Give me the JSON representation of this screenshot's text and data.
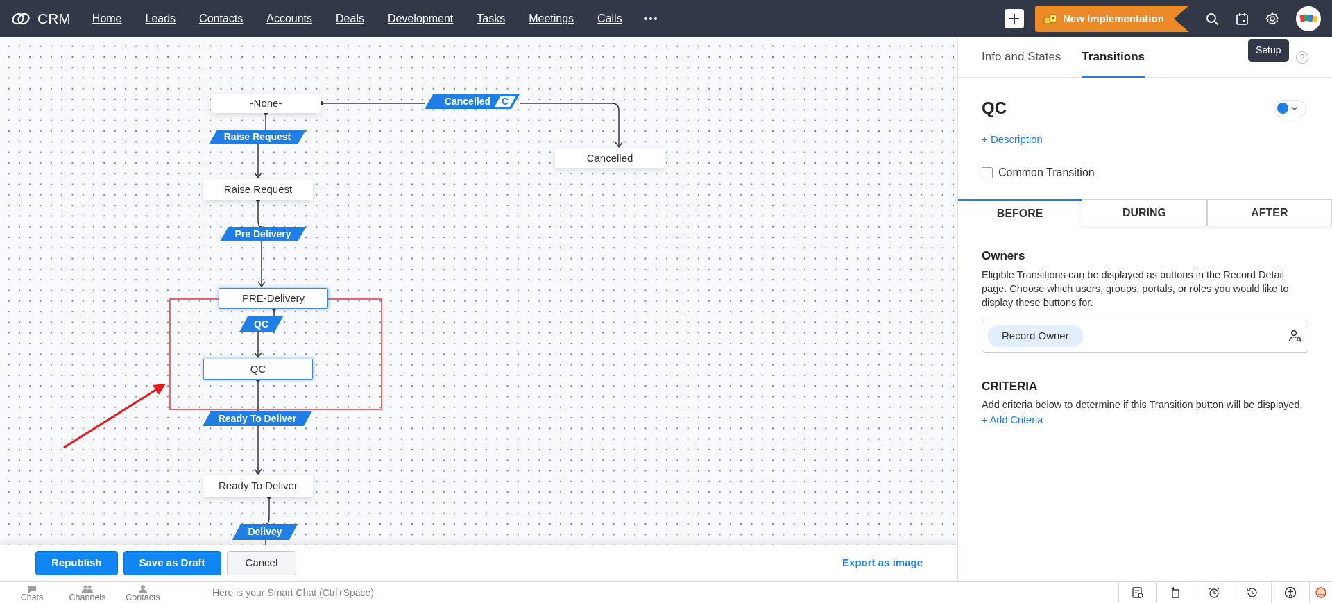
{
  "navbar": {
    "brand": "CRM",
    "items": [
      "Home",
      "Leads",
      "Contacts",
      "Accounts",
      "Deals",
      "Development",
      "Tasks",
      "Meetings",
      "Calls"
    ],
    "new_implementation": "New Implementation",
    "tooltip": "Setup"
  },
  "canvas": {
    "states": [
      {
        "label": "-None-",
        "selected": false
      },
      {
        "label": "Cancelled",
        "selected": false
      },
      {
        "label": "Raise Request",
        "selected": false
      },
      {
        "label": "PRE-Delivery",
        "selected": true
      },
      {
        "label": "QC",
        "selected": true
      },
      {
        "label": "Ready To Deliver",
        "selected": false
      }
    ],
    "transitions": [
      {
        "label": "Cancelled",
        "badge": "C"
      },
      {
        "label": "Raise Request"
      },
      {
        "label": "Pre Delivery"
      },
      {
        "label": "QC"
      },
      {
        "label": "Ready To Deliver"
      },
      {
        "label": "Delivey"
      }
    ],
    "actions": [
      {
        "label": "Republish",
        "kind": "primary"
      },
      {
        "label": "Save as Draft",
        "kind": "primary"
      },
      {
        "label": "Cancel",
        "kind": "secondary"
      }
    ],
    "export": "Export as image"
  },
  "panel": {
    "tabs": [
      {
        "label": "Info and States",
        "selected": false
      },
      {
        "label": "Transitions",
        "selected": true
      }
    ],
    "help": "?",
    "title": "QC",
    "color": "#1f7fe5",
    "description_link": "+ Description",
    "common_transition": {
      "label": "Common Transition",
      "checked": false
    },
    "phases": [
      {
        "label": "BEFORE",
        "selected": true
      },
      {
        "label": "DURING",
        "selected": false
      },
      {
        "label": "AFTER",
        "selected": false
      }
    ],
    "owners": {
      "heading": "Owners",
      "text": "Eligible Transitions can be displayed as buttons in the Record Detail page. Choose which users, groups, portals, or roles you would like to display these buttons for.",
      "chips": [
        "Record Owner"
      ]
    },
    "criteria": {
      "heading": "CRITERIA",
      "text": "Add criteria below to determine if this Transition button will be displayed.",
      "link": "+ Add Criteria"
    }
  },
  "chat_bar": {
    "tabs": [
      "Chats",
      "Channels",
      "Contacts"
    ],
    "placeholder": "Here is your Smart Chat (Ctrl+Space)"
  }
}
